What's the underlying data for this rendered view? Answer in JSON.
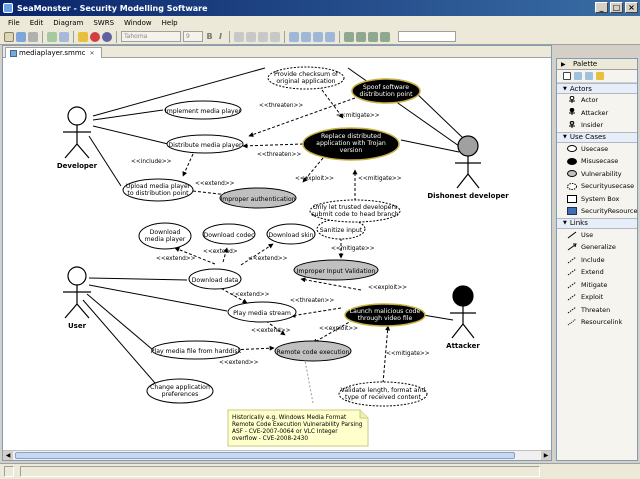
{
  "window": {
    "title": "SeaMonster - Security Modelling Software"
  },
  "menu": [
    "File",
    "Edit",
    "Diagram",
    "SWRS",
    "Window",
    "Help"
  ],
  "toolbar": {
    "font_combo": "Tahoma",
    "size_combo": "9"
  },
  "tab": {
    "label": "mediaplayer.smmc"
  },
  "actors": {
    "developer": "Developer",
    "dishonest": "Dishonest developer",
    "user": "User",
    "attacker": "Attacker"
  },
  "usecases": {
    "checksum": [
      "Provide checksum of",
      "original application"
    ],
    "implement": [
      "Implement media player"
    ],
    "distribute": [
      "Distribute media player"
    ],
    "upload": [
      "Upload media player",
      "to distribution point"
    ],
    "download_player": [
      "Download",
      "media player"
    ],
    "download_codec": [
      "Download codec"
    ],
    "download_skin": [
      "Download skin"
    ],
    "download_data": [
      "Download data"
    ],
    "play_stream": [
      "Play media stream"
    ],
    "play_file": [
      "Play media file from harddisk"
    ],
    "change_prefs": [
      "Change application",
      "preferences"
    ],
    "sanitize": [
      "Sanitize input"
    ],
    "trusted_devs": [
      "Only let trusted developers",
      "submit code to head branch"
    ],
    "validate": [
      "Validate length, format and",
      "type of received content"
    ]
  },
  "misuses": {
    "spoof": [
      "Spoof software",
      "distribution point"
    ],
    "replace": [
      "Replace distributed",
      "application with Trojan",
      "version"
    ],
    "launch": [
      "Launch malicious code",
      "through video file"
    ]
  },
  "vulns": {
    "auth": [
      "Improper authentication"
    ],
    "input": [
      "Improper Input Validation"
    ],
    "rce": [
      "Remote code execution"
    ]
  },
  "labels": {
    "threaten": "<<threaten>>",
    "mitigate": "<<mitigate>>",
    "include": "<<include>>",
    "extend": "<<extend>>",
    "exploit": "<<exploit>>",
    "extend_short": "<<extend>"
  },
  "note": {
    "lines": [
      "Historically e.g. Windows Media Format",
      "Remote Code Execution Vulnerability Parsing",
      "ASF - CVE-2007-0064 or VLC Integer",
      "overflow - CVE-2008-2430"
    ]
  },
  "palette": {
    "title": "Palette",
    "drawers": [
      {
        "title": "Actors",
        "items": [
          "Actor",
          "Attacker",
          "Insider"
        ]
      },
      {
        "title": "Use Cases",
        "items": [
          "Usecase",
          "Misusecase",
          "Vulnerability",
          "Securityusecase",
          "System Box",
          "SecurityResource"
        ]
      },
      {
        "title": "Links",
        "items": [
          "Use",
          "Generalize",
          "Include",
          "Extend",
          "Mitigate",
          "Exploit",
          "Threaten",
          "Resourcelink"
        ]
      }
    ]
  },
  "colors": {
    "misuse_fill": "#000000",
    "vuln_fill": "#c0c0c0",
    "note_fill": "#ffffcc",
    "title_bar": "#0a246a",
    "attacker_head": "#000000",
    "insider_head": "#a0a0a0"
  }
}
